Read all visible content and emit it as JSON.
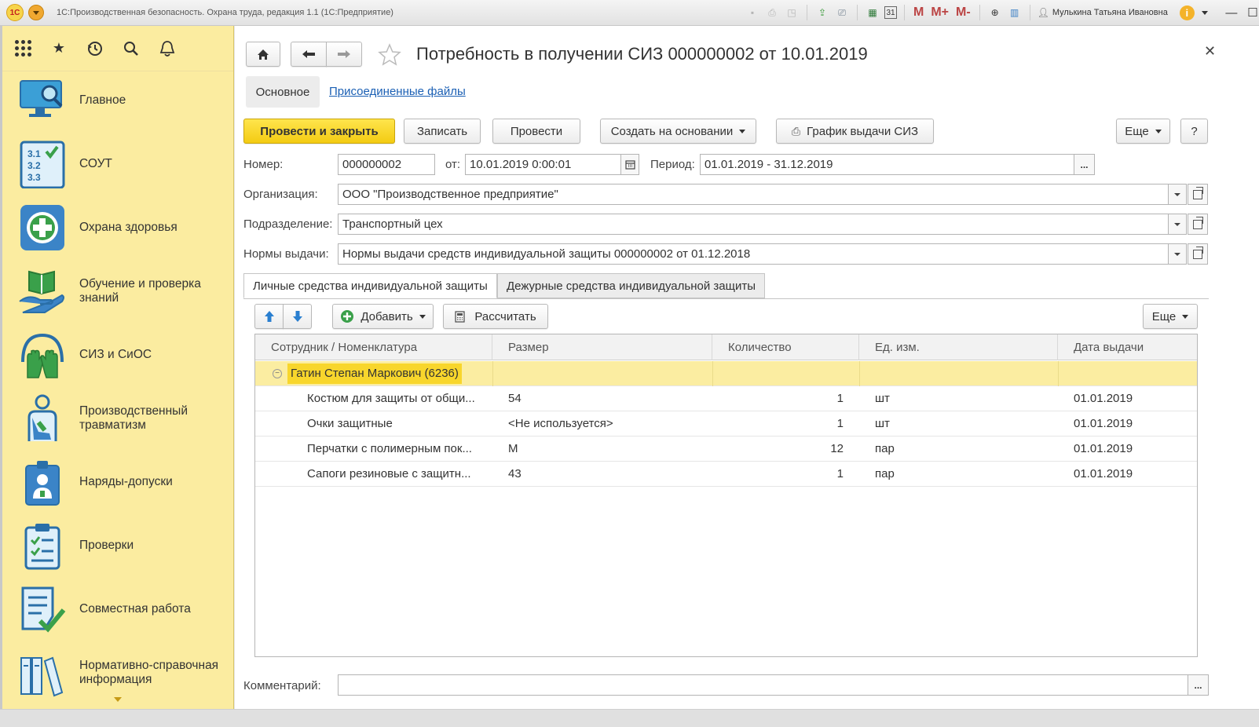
{
  "window": {
    "app_title": "1С:Производственная безопасность. Охрана труда, редакция 1.1  (1С:Предприятие)",
    "user": "Мулькина Татьяна Ивановна",
    "m_labels": [
      "M",
      "M+",
      "M-"
    ],
    "calendar_day": "31"
  },
  "sidebar": {
    "items": [
      {
        "label": "Главное",
        "icon": "monitor-magnifier-icon"
      },
      {
        "label": "СОУТ",
        "icon": "checklist-numbers-icon"
      },
      {
        "label": "Охрана здоровья",
        "icon": "medical-cross-icon"
      },
      {
        "label": "Обучение и проверка знаний",
        "icon": "book-hand-icon"
      },
      {
        "label": "СИЗ и СиОС",
        "icon": "helmet-gloves-icon"
      },
      {
        "label": "Производственный травматизм",
        "icon": "injured-person-icon"
      },
      {
        "label": "Наряды-допуски",
        "icon": "permit-badge-icon"
      },
      {
        "label": "Проверки",
        "icon": "clipboard-check-icon"
      },
      {
        "label": "Совместная работа",
        "icon": "document-check-icon"
      },
      {
        "label": "Нормативно-справочная информация",
        "icon": "binders-icon"
      }
    ]
  },
  "form": {
    "title": "Потребность в получении СИЗ 000000002 от 10.01.2019",
    "nav_tabs": {
      "main": "Основное",
      "files": "Присоединенные файлы"
    },
    "toolbar": {
      "post_close": "Провести и закрыть",
      "save": "Записать",
      "post": "Провести",
      "create_based": "Создать на основании",
      "schedule": "График выдачи СИЗ",
      "more": "Еще",
      "help": "?"
    },
    "fields": {
      "number_label": "Номер:",
      "number_value": "000000002",
      "date_label": "от:",
      "date_value": "10.01.2019  0:00:01",
      "period_label": "Период:",
      "period_value": "01.01.2019 - 31.12.2019",
      "org_label": "Организация:",
      "org_value": "ООО \"Производственное предприятие\"",
      "dept_label": "Подразделение:",
      "dept_value": "Транспортный цех",
      "norms_label": "Нормы выдачи:",
      "norms_value": "Нормы выдачи средств индивидуальной защиты 000000002 от 01.12.2018",
      "comment_label": "Комментарий:",
      "comment_value": "",
      "ellipsis": "..."
    },
    "tabs": [
      "Личные средства индивидуальной защиты",
      "Дежурные средства индивидуальной защиты"
    ],
    "table_toolbar": {
      "add": "Добавить",
      "calculate": "Рассчитать",
      "more": "Еще"
    },
    "table": {
      "columns": [
        "Сотрудник / Номенклатура",
        "Размер",
        "Количество",
        "Ед. изм.",
        "Дата выдачи"
      ],
      "group": "Гатин Степан Маркович (6236)",
      "rows": [
        {
          "name": "Костюм для защиты от общи...",
          "size": "54",
          "qty": "1",
          "unit": "шт",
          "date": "01.01.2019"
        },
        {
          "name": "Очки защитные",
          "size": "<Не используется>",
          "qty": "1",
          "unit": "шт",
          "date": "01.01.2019"
        },
        {
          "name": "Перчатки с полимерным пок...",
          "size": "М",
          "qty": "12",
          "unit": "пар",
          "date": "01.01.2019"
        },
        {
          "name": "Сапоги резиновые с защитн...",
          "size": "43",
          "qty": "1",
          "unit": "пар",
          "date": "01.01.2019"
        }
      ]
    }
  },
  "colors": {
    "accent_yellow": "#f3cb12",
    "sidebar_bg": "#fbeca0",
    "link": "#1a5fb4",
    "icon_blue": "#3b7fc4"
  }
}
